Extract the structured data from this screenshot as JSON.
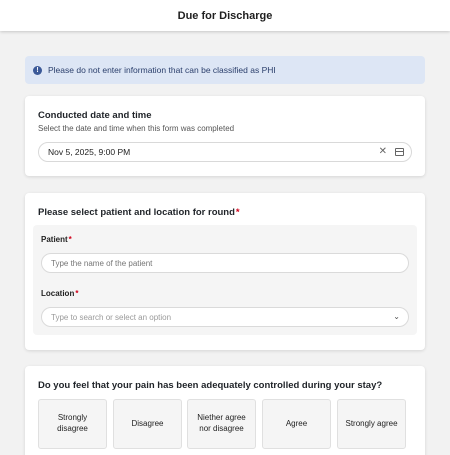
{
  "header": {
    "title": "Due for Discharge"
  },
  "banner": {
    "icon": "info-icon",
    "text": "Please do not enter information that can be classified as PHI"
  },
  "conducted": {
    "title": "Conducted date and time",
    "subtitle": "Select the date and time when this form was completed",
    "value": "Nov 5, 2025, 9:00 PM",
    "clear_icon": "close-icon",
    "calendar_icon": "calendar-icon"
  },
  "round": {
    "title": "Please select patient and location for round",
    "required_mark": "*",
    "patient_label": "Patient",
    "patient_placeholder": "Type the name of the patient",
    "location_label": "Location",
    "location_placeholder": "Type to search or select an option"
  },
  "question": {
    "title": "Do you feel that your pain has been adequately controlled during your stay?",
    "options": [
      "Strongly disagree",
      "Disagree",
      "Niether agree nor disagree",
      "Agree",
      "Strongly agree"
    ]
  },
  "colors": {
    "accent": "#3b5998",
    "banner_bg": "#dde6f5",
    "required": "#d0021b"
  }
}
